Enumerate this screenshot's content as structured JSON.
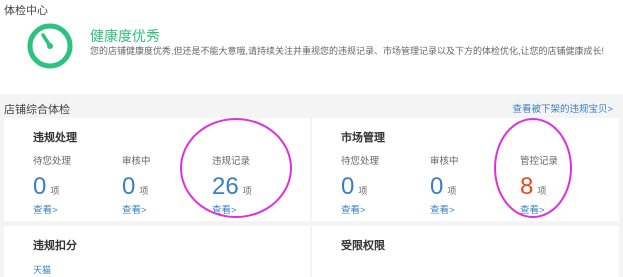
{
  "page": {
    "title": "体检中心"
  },
  "health": {
    "status": "健康度优秀",
    "description": "您的店铺健康度优秀,但还是不能大意哦,请持续关注并重视您的违规记录、市场管理记录以及下方的体检优化,让您的店铺健康成长!",
    "accent_color": "#2ec27e",
    "gauge_icon": "stopwatch-gauge-icon"
  },
  "overview": {
    "label": "店铺综合体检",
    "view_removed_link": "查看被下架的违规宝贝>"
  },
  "violations": {
    "title": "违规处理",
    "stats": [
      {
        "label": "待您处理",
        "value": "0",
        "unit": "项",
        "link": "查看>"
      },
      {
        "label": "审核中",
        "value": "0",
        "unit": "项",
        "link": "查看>"
      },
      {
        "label": "违规记录",
        "value": "26",
        "unit": "项",
        "link": "查看>"
      }
    ]
  },
  "market": {
    "title": "市场管理",
    "stats": [
      {
        "label": "待您处理",
        "value": "0",
        "unit": "项",
        "link": "查看>"
      },
      {
        "label": "审核中",
        "value": "0",
        "unit": "项",
        "link": "查看>"
      },
      {
        "label": "管控记录",
        "value": "8",
        "unit": "项",
        "link": "查看>"
      }
    ]
  },
  "deduction": {
    "title": "违规扣分",
    "link": "天猫"
  },
  "restriction": {
    "title": "受限权限"
  },
  "colors": {
    "link_blue": "#3a7fc1",
    "value_blue": "#3a7fc1",
    "value_red": "#e24a1a",
    "annotation_magenta": "#e02ee0"
  }
}
